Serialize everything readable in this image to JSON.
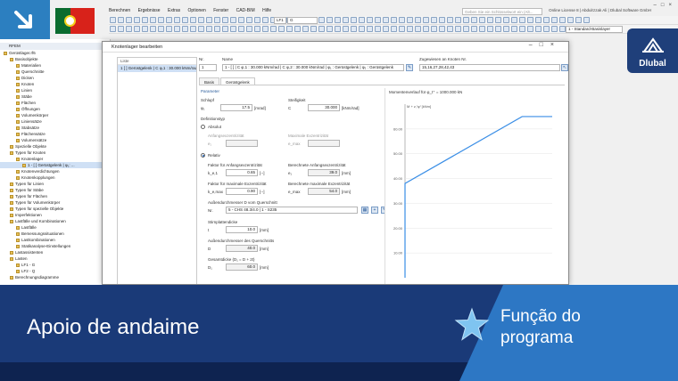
{
  "menu": [
    "Berechnen",
    "Ergebnisse",
    "Extras",
    "Optionen",
    "Fenster",
    "CAD-BIM",
    "Hilfe"
  ],
  "search_placeholder": "Geben Sie ein Schlüsselwort ein (Alt...",
  "license": "Online License 8 | Abdulrzzak Ali | Dlubal Software GmbH",
  "toolbar": {
    "lc_label": "LF1",
    "lc_value": "G",
    "view_combo": "1 - Standard-Basislayer"
  },
  "brand": {
    "logo": "Dlubal",
    "accent": "#1f3f7a",
    "banner_light": "#2d77c4"
  },
  "navigator": {
    "title": "RFEM",
    "items": [
      {
        "label": "Gerüstlager.rf6",
        "level": 0
      },
      {
        "label": "Basisobjekte",
        "level": 1
      },
      {
        "label": "Materialien",
        "level": 2
      },
      {
        "label": "Querschnitte",
        "level": 2
      },
      {
        "label": "Dicken",
        "level": 2
      },
      {
        "label": "Knoten",
        "level": 2
      },
      {
        "label": "Linien",
        "level": 2
      },
      {
        "label": "Stäbe",
        "level": 2
      },
      {
        "label": "Flächen",
        "level": 2
      },
      {
        "label": "Öffnungen",
        "level": 2
      },
      {
        "label": "Volumenkörper",
        "level": 2
      },
      {
        "label": "Liniensätze",
        "level": 2
      },
      {
        "label": "Stabsätze",
        "level": 2
      },
      {
        "label": "Flächensätze",
        "level": 2
      },
      {
        "label": "Volumensätze",
        "level": 2
      },
      {
        "label": "Spezielle Objekte",
        "level": 1
      },
      {
        "label": "Typen für Knoten",
        "level": 1
      },
      {
        "label": "Knotenlager",
        "level": 2
      },
      {
        "label": "1 - [ ] Gerüstgelenk | φ₁: ...",
        "level": 3,
        "selected": true
      },
      {
        "label": "Knotenverdichtungen",
        "level": 2
      },
      {
        "label": "Knotenkopplungen",
        "level": 2
      },
      {
        "label": "Typen für Linien",
        "level": 1
      },
      {
        "label": "Typen für Stäbe",
        "level": 1
      },
      {
        "label": "Typen für Flächen",
        "level": 1
      },
      {
        "label": "Typen für Volumenkörper",
        "level": 1
      },
      {
        "label": "Typen für spezielle Objekte",
        "level": 1
      },
      {
        "label": "Imperfektionen",
        "level": 1
      },
      {
        "label": "Lastfälle und Kombinationen",
        "level": 1
      },
      {
        "label": "Lastfälle",
        "level": 2
      },
      {
        "label": "Bemessungssituationen",
        "level": 2
      },
      {
        "label": "Lastkombinationen",
        "level": 2
      },
      {
        "label": "Statikanalyse-Einstellungen",
        "level": 2
      },
      {
        "label": "Lastassistenten",
        "level": 1
      },
      {
        "label": "Lasten",
        "level": 1
      },
      {
        "label": "LF1 - G",
        "level": 2
      },
      {
        "label": "LF2 - Q",
        "level": 2
      },
      {
        "label": "Berechnungsdiagramme",
        "level": 1
      }
    ]
  },
  "dialog": {
    "title": "Knotenlager bearbeiten",
    "list_header": "Liste",
    "list_item": "1  [ ]  Gerüstgelenk | C φ,1 : 30.000 kNm/rad",
    "no_label": "Nr.",
    "no_value": "1",
    "name_label": "Name",
    "name_value": "1 - [ ] | C φ,1 : 30.000 kNm/rad | C φ,2 : 30.000 kNm/rad | φ₁ : Gerüstgelenk | φ₂ : Gerüstgelenk",
    "assigned_label": "Zugewiesen an Knoten Nr.",
    "assigned_value": "15,16,27,28,42,43",
    "tabs": [
      "Basis",
      "Gerüstgelenk"
    ],
    "active_tab": 1,
    "section_param": "Parameter",
    "slip_label": "Schlupf",
    "slip_sym": "φ₁",
    "slip_value": "17.5",
    "slip_unit": "[mrad]",
    "stiff_label": "Steifigkeit",
    "stiff_sym": "C",
    "stiff_value": "30.000",
    "stiff_unit": "[kNm/rad]",
    "def_type": "Definitionstyp",
    "absolute": "Absolut",
    "initial_ecc": "Anfangsexzentrizität",
    "e1_sym": "e₁",
    "max_ecc": "Maximale Exzentrizität",
    "emax_sym": "e_max",
    "relative": "Relativ",
    "factor_initial": "Faktor für Anfangsexzentrizität",
    "f_sym": "k_e,1",
    "f_value": "0.65",
    "f_unit": "[--]",
    "calc_initial": "Berechnete Anfangsexzentrizität",
    "ce1_sym": "e₁",
    "ce1_value": "39.0",
    "ce1_unit": "[mm]",
    "factor_max": "Faktor für maximale Exzentrizität",
    "fm_sym": "k_e,max",
    "fm_value": "0.90",
    "fm_unit": "[--]",
    "calc_max": "Berechnete maximale Exzentrizität",
    "cmax_sym": "e_max",
    "cmax_value": "54.0",
    "cmax_unit": "[mm]",
    "outer_dia": "Außendurchmesser D vom Querschnitt",
    "section_no": "Nr.",
    "section_value": "5 - CHS 48.3/4.0 | 1 - S235",
    "plate_label": "Stirnplattendicke",
    "plate_sym": "t",
    "plate_value": "10.0",
    "plate_unit": "[mm]",
    "outer_cs_label": "Außendurchmesser des Querschnitts",
    "d_sym": "D",
    "d_value": "40.0",
    "d_unit": "[mm]",
    "total_label": "Gesamtdicke (D₁ = D + 2t)",
    "total_sym": "D₁",
    "total_value": "60.0",
    "total_unit": "[mm]"
  },
  "chart_data": {
    "type": "line",
    "title": "Momentenverlauf für φ_t⁺ = 1000.000 kN",
    "ylabel": "M + z,⁽φ⁾ [kNm]",
    "y_ticks": [
      10.0,
      20.0,
      30.0,
      40.0,
      50.0,
      60.0
    ],
    "ylim": [
      0,
      70
    ],
    "x": [
      0,
      0,
      17.5,
      22
    ],
    "y": [
      0,
      38,
      65,
      65
    ]
  },
  "banner": {
    "title": "Apoio de andaime",
    "subtitle_line1": "Função do",
    "subtitle_line2": "programa"
  }
}
